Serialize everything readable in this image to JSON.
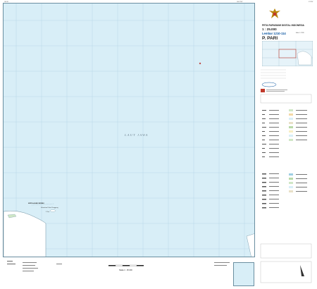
{
  "header": {
    "title": "PETA RUPABUMI DIGITAL INDONESIA",
    "scale": "1 : 25.000",
    "sheet": "Lembar 1210-114",
    "name": "P. PARI",
    "edition": "Edisi I - 1999"
  },
  "map": {
    "sea_label": "LAUT JAWA",
    "place_label": "KEPULAUAN SERIBU",
    "place_sub": "Kelurahan Pulau Panggang",
    "place_sub2": "P. Pari",
    "corner_top_left": "106°30'",
    "corner_top_right": "106°37'30\"",
    "corner_far_right": "5°52'30\""
  },
  "bottom": {
    "scale_text": "Skala 1 : 25.000"
  },
  "colors": {
    "sea": "#d8eef7",
    "frame": "#6a8ea0",
    "grid": "#b7d8e8",
    "land": "#ffffff",
    "accent": "#0a55a0"
  }
}
